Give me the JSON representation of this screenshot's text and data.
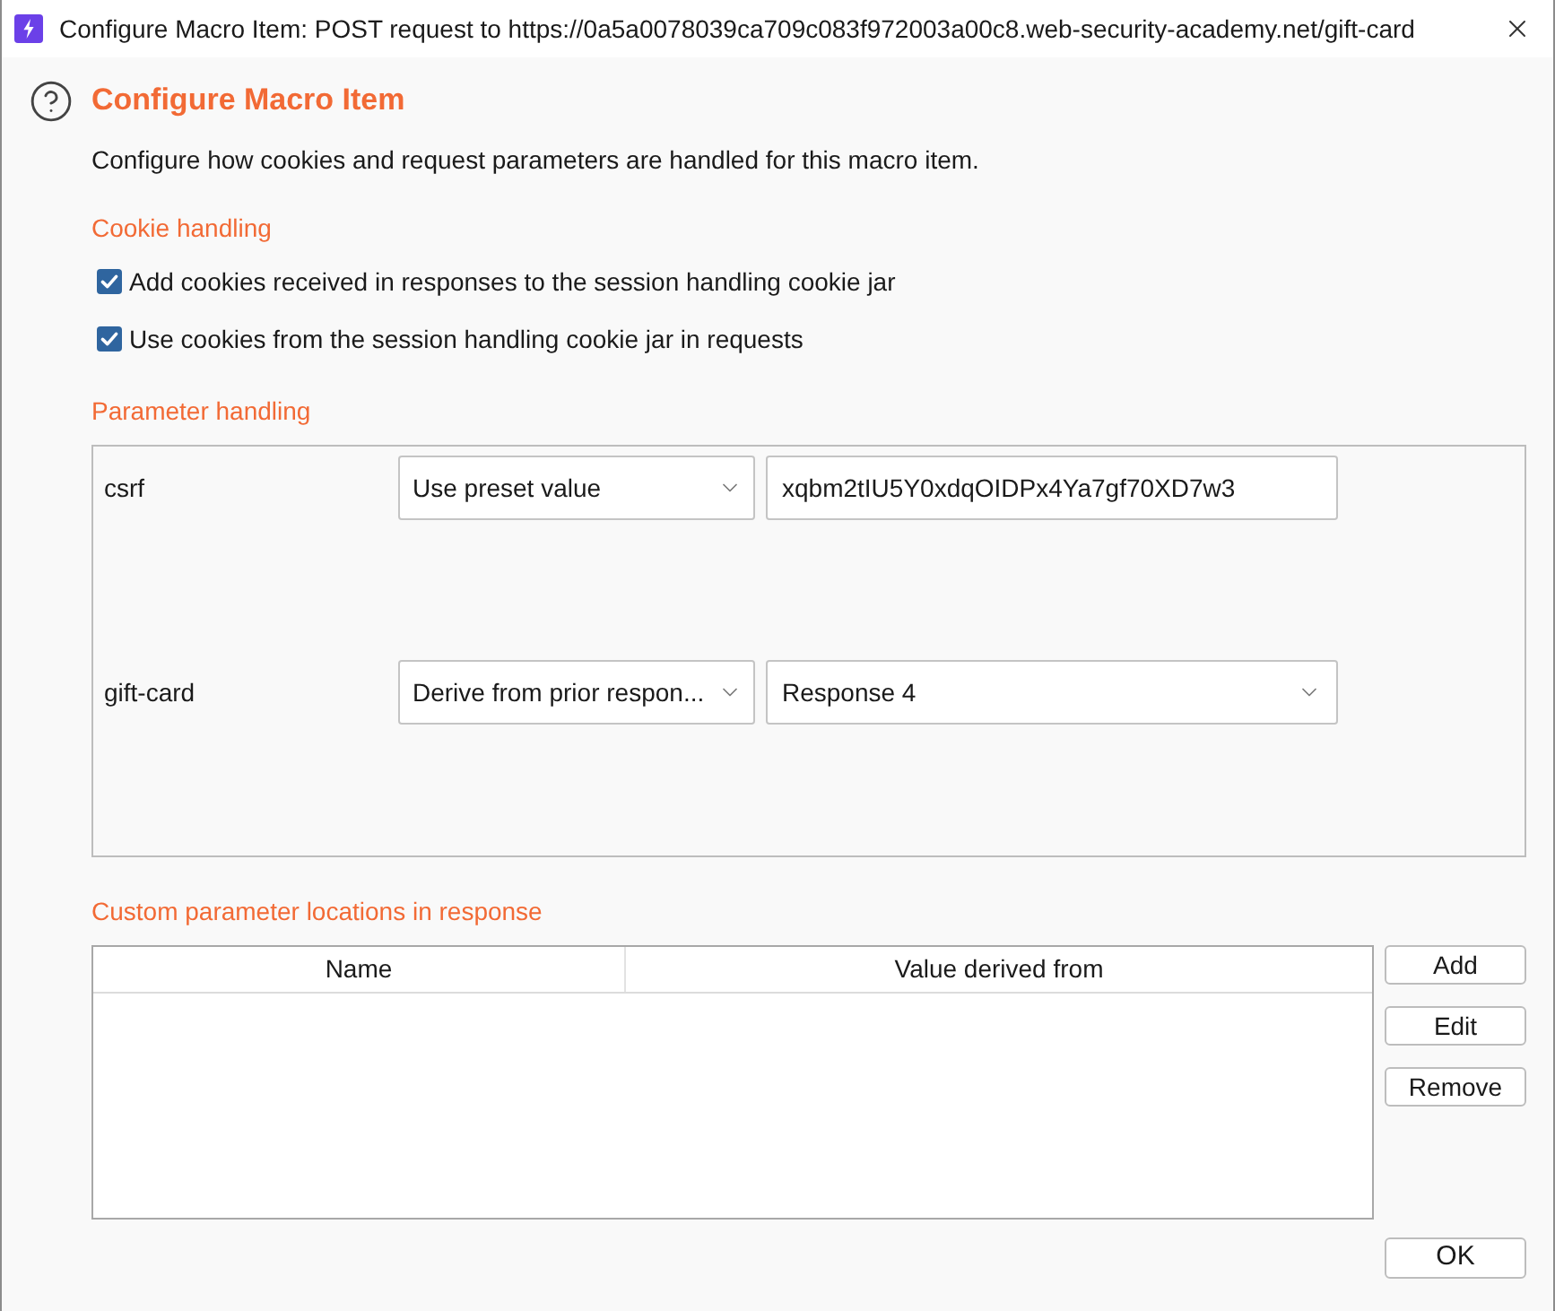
{
  "window": {
    "title": "Configure Macro Item: POST request to https://0a5a0078039ca709c083f972003a00c8.web-security-academy.net/gift-card"
  },
  "header": {
    "title": "Configure Macro Item",
    "description": "Configure how cookies and request parameters are handled for this macro item."
  },
  "cookie_handling": {
    "title": "Cookie handling",
    "options": [
      {
        "label": "Add cookies received in responses to the session handling cookie jar",
        "checked": true
      },
      {
        "label": "Use cookies from the session handling cookie jar in requests",
        "checked": true
      }
    ]
  },
  "parameter_handling": {
    "title": "Parameter handling",
    "parameters": [
      {
        "name": "csrf",
        "mode": "Use preset value",
        "kind": "text",
        "value": "xqbm2tIU5Y0xdqOIDPx4Ya7gf70XD7w3"
      },
      {
        "name": "gift-card",
        "mode": "Derive from prior respon...",
        "kind": "select",
        "value": "Response 4"
      }
    ]
  },
  "custom_locations": {
    "title": "Custom parameter locations in response",
    "columns": [
      "Name",
      "Value derived from"
    ],
    "buttons": [
      "Add",
      "Edit",
      "Remove"
    ]
  },
  "footer_buttons": [
    "OK"
  ]
}
